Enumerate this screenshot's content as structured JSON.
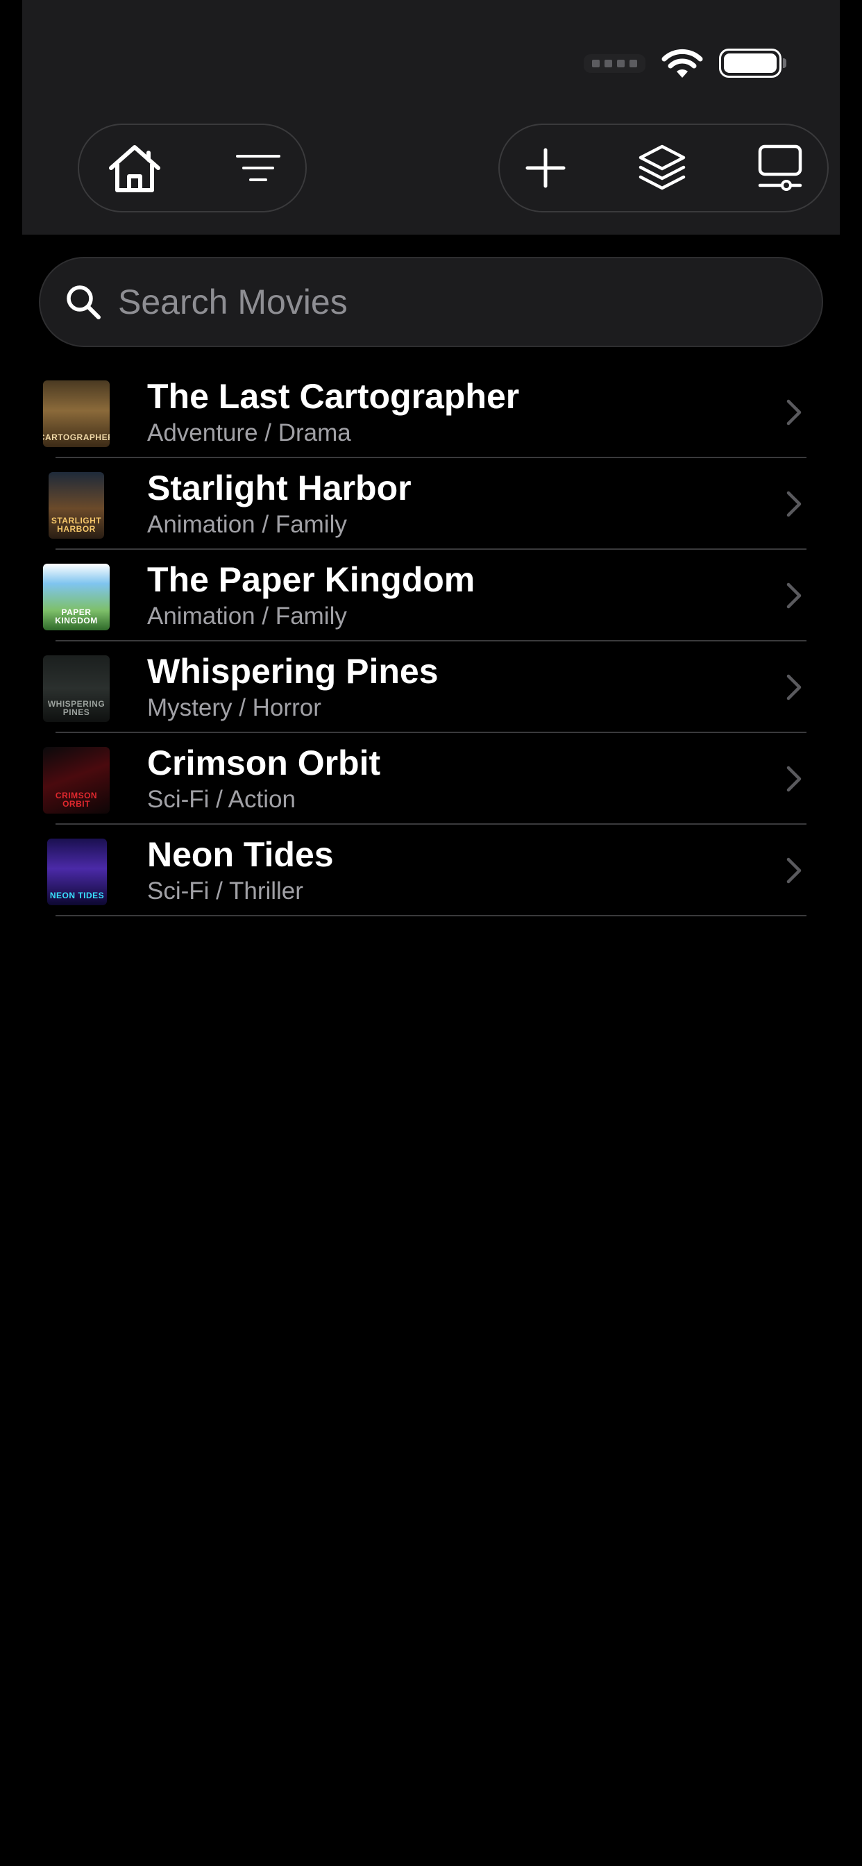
{
  "status_bar": {
    "icons": [
      "signal-dots-icon",
      "wifi-icon",
      "battery-icon"
    ],
    "battery_level": 1.0
  },
  "toolbar": {
    "left_group": [
      "home-icon",
      "filter-icon"
    ],
    "right_group": [
      "add-icon",
      "layers-icon",
      "display-settings-icon"
    ]
  },
  "search": {
    "placeholder": "Search Movies",
    "value": "",
    "icon": "search-icon"
  },
  "movies": [
    {
      "title": "The Last Cartographer",
      "genre": "Adventure / Drama",
      "poster_text": "CARTOGRAPHER"
    },
    {
      "title": "Starlight Harbor",
      "genre": "Animation / Family",
      "poster_text": "STARLIGHT HARBOR"
    },
    {
      "title": "The Paper Kingdom",
      "genre": "Animation / Family",
      "poster_text": "PAPER KINGDOM"
    },
    {
      "title": "Whispering Pines",
      "genre": "Mystery / Horror",
      "poster_text": "WHISPERING PINES"
    },
    {
      "title": "Crimson Orbit",
      "genre": "Sci-Fi / Action",
      "poster_text": "CRIMSON ORBIT"
    },
    {
      "title": "Neon Tides",
      "genre": "Sci-Fi / Thriller",
      "poster_text": "NEON TIDES"
    }
  ],
  "colors": {
    "background": "#000000",
    "bar_background": "#1c1c1e",
    "separator": "#3a3a3c",
    "secondary_text": "#a1a1a6",
    "chevron": "#5a5a5e"
  }
}
